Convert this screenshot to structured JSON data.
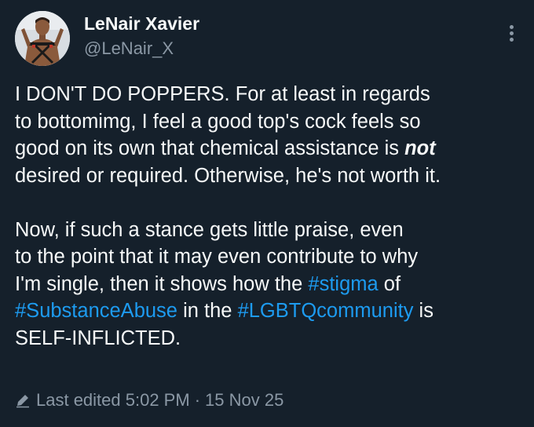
{
  "author": {
    "name": "LeNair Xavier",
    "handle": "@LeNair_X",
    "avatar_icon": "profile-photo"
  },
  "menu": {
    "icon": "more-vertical-icon"
  },
  "tweet": {
    "p1": {
      "l1": "I DON'T DO POPPERS. For at least in regards",
      "l2": "to bottomimg, I feel a good top's cock feels so",
      "l3_pre": "good on its own that chemical assistance is ",
      "l3_em": "not",
      "l4": "desired or required. Otherwise, he's not worth it."
    },
    "p2": {
      "l1": "Now, if such a stance gets little praise, even",
      "l2": "to the point that it may even contribute to why",
      "l3_pre": "I'm single, then it shows how the ",
      "l3_tag": "#stigma",
      "l3_post": " of",
      "l4_tag1": "#SubstanceAbuse",
      "l4_mid": " in the ",
      "l4_tag2": "#LGBTQcommunity",
      "l4_post": " is",
      "l5": "SELF-INFLICTED."
    }
  },
  "footer": {
    "edit_icon": "pencil-icon",
    "label": "Last edited 5:02 PM",
    "separator": "·",
    "date": "15 Nov 25"
  },
  "colors": {
    "background": "#15202b",
    "text": "#f7f9f9",
    "secondary": "#8b98a5",
    "link": "#1d9bf0"
  }
}
